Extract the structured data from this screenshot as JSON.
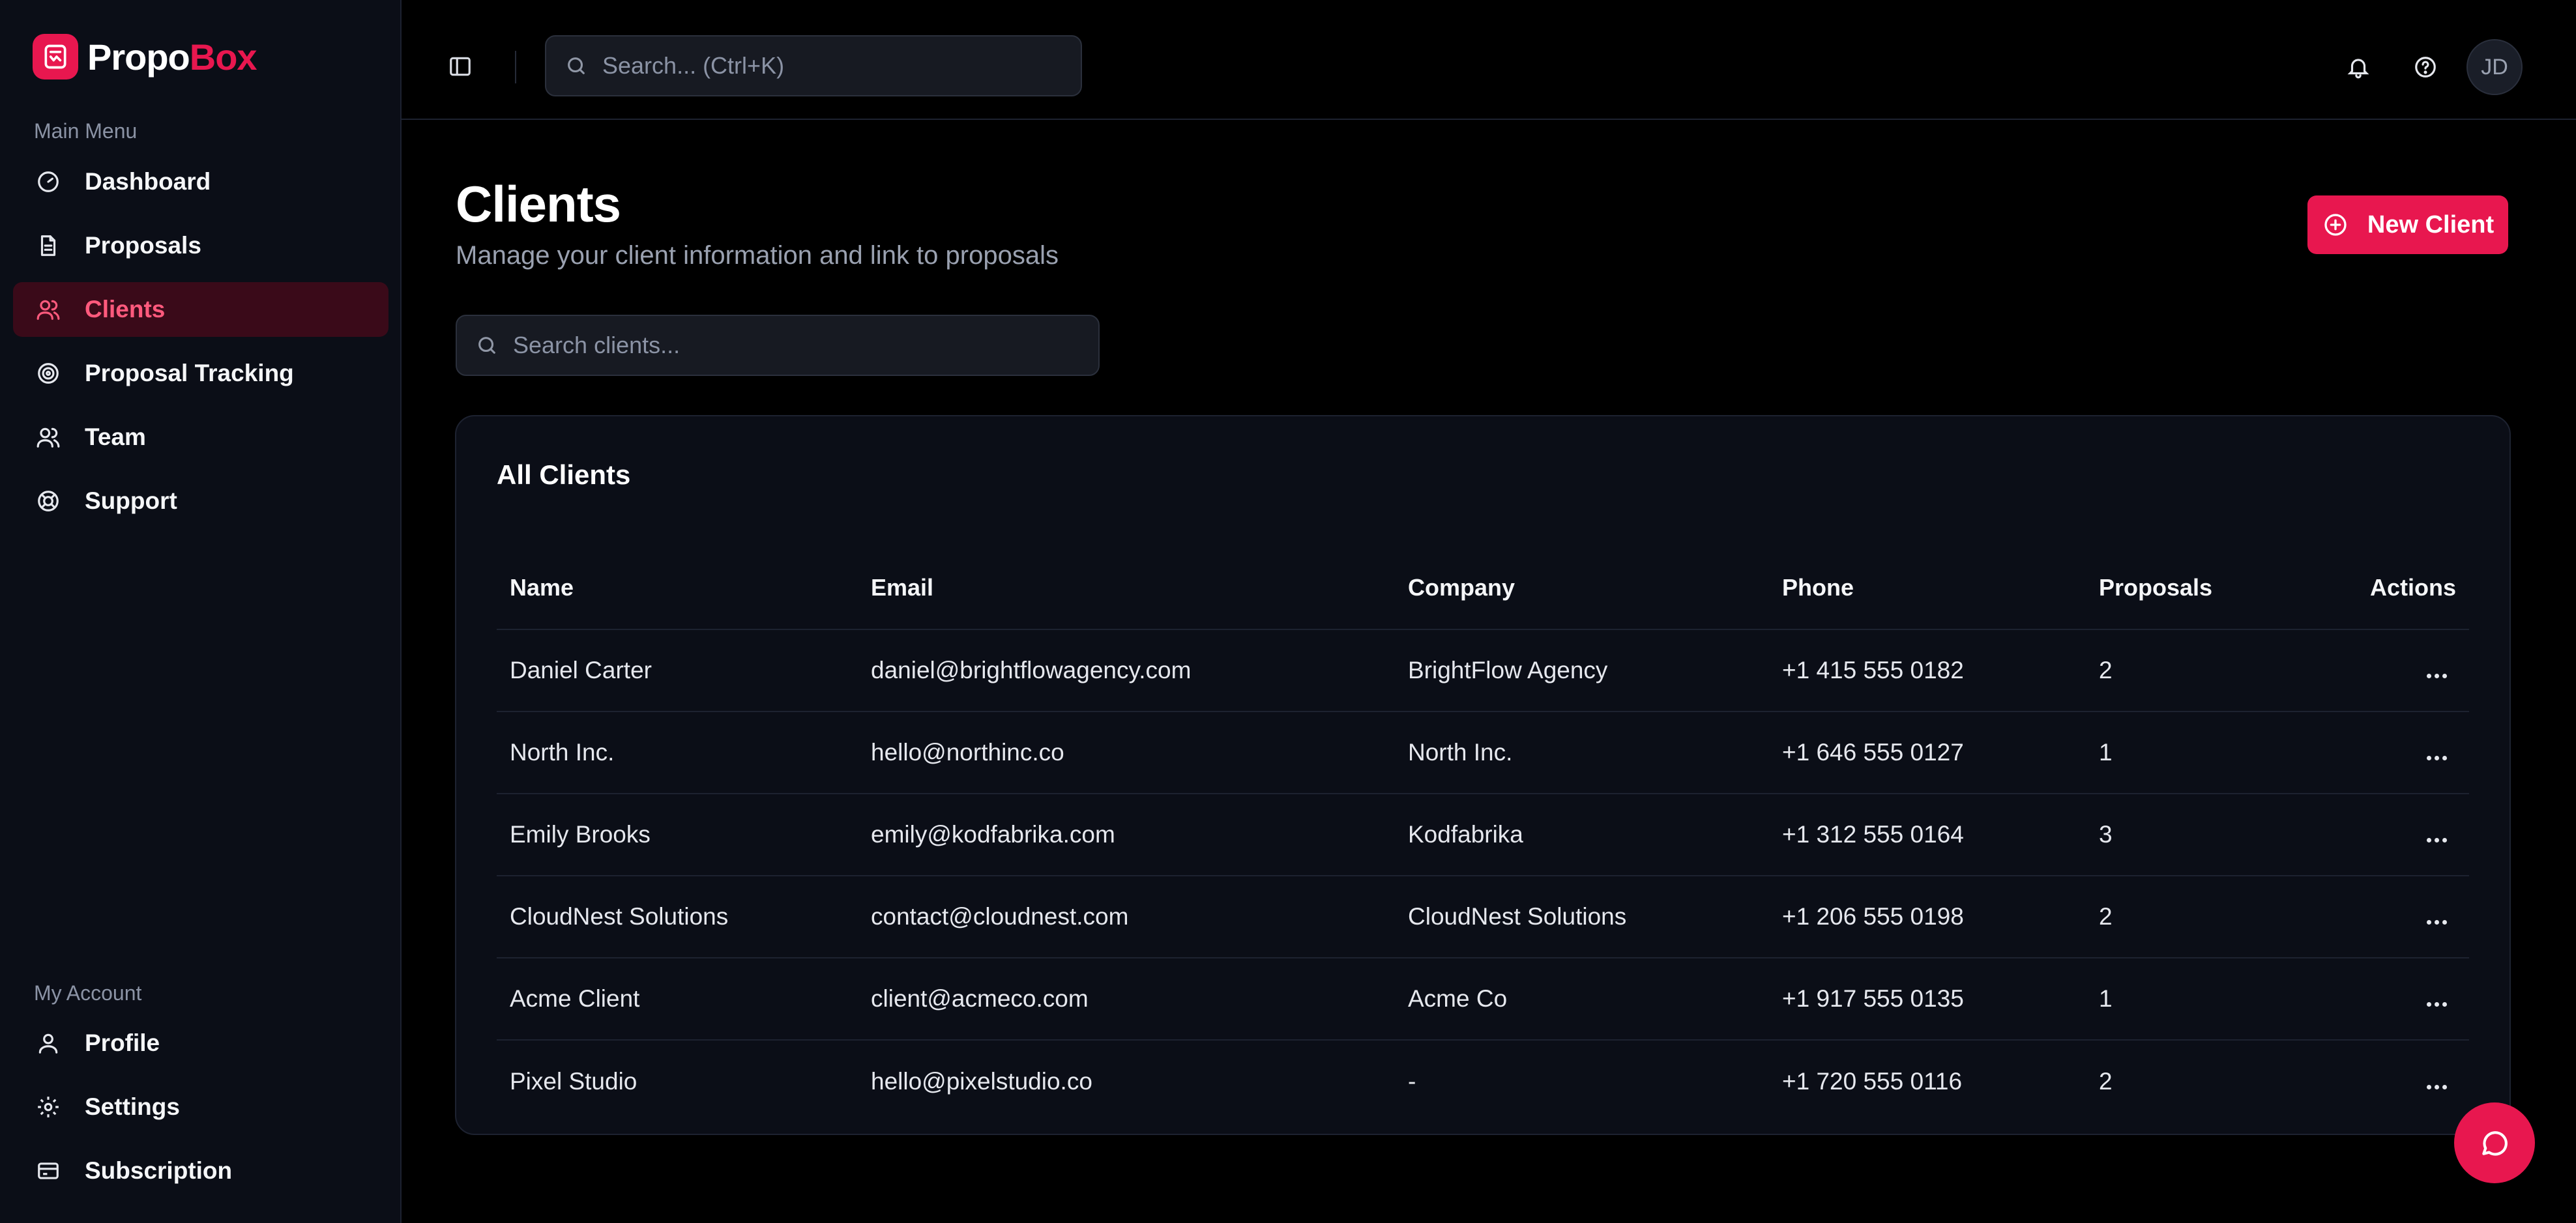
{
  "brand": {
    "name_part1": "Propo",
    "name_part2": "Box",
    "accent_color": "#e8174f"
  },
  "sidebar": {
    "main_menu_label": "Main Menu",
    "main_items": [
      {
        "label": "Dashboard",
        "icon": "gauge-icon"
      },
      {
        "label": "Proposals",
        "icon": "document-icon"
      },
      {
        "label": "Clients",
        "icon": "users-icon",
        "active": true
      },
      {
        "label": "Proposal Tracking",
        "icon": "target-icon"
      },
      {
        "label": "Team",
        "icon": "team-icon"
      },
      {
        "label": "Support",
        "icon": "lifebuoy-icon"
      }
    ],
    "account_label": "My Account",
    "account_items": [
      {
        "label": "Profile",
        "icon": "user-icon"
      },
      {
        "label": "Settings",
        "icon": "gear-icon"
      },
      {
        "label": "Subscription",
        "icon": "credit-card-icon"
      }
    ]
  },
  "topbar": {
    "search_placeholder": "Search... (Ctrl+K)",
    "avatar_initials": "JD"
  },
  "page": {
    "title": "Clients",
    "subtitle": "Manage your client information and link to proposals",
    "new_button_label": "New Client",
    "search_placeholder": "Search clients..."
  },
  "table": {
    "card_title": "All Clients",
    "columns": [
      "Name",
      "Email",
      "Company",
      "Phone",
      "Proposals",
      "Actions"
    ],
    "rows": [
      {
        "name": "Daniel Carter",
        "email": "daniel@brightflowagency.com",
        "company": "BrightFlow Agency",
        "phone": "+1 415 555 0182",
        "proposals": "2"
      },
      {
        "name": "North Inc.",
        "email": "hello@northinc.co",
        "company": "North Inc.",
        "phone": "+1 646 555 0127",
        "proposals": "1"
      },
      {
        "name": "Emily Brooks",
        "email": "emily@kodfabrika.com",
        "company": "Kodfabrika",
        "phone": "+1 312 555 0164",
        "proposals": "3"
      },
      {
        "name": "CloudNest Solutions",
        "email": "contact@cloudnest.com",
        "company": "CloudNest Solutions",
        "phone": "+1 206 555 0198",
        "proposals": "2"
      },
      {
        "name": "Acme Client",
        "email": "client@acmeco.com",
        "company": "Acme Co",
        "phone": "+1 917 555 0135",
        "proposals": "1"
      },
      {
        "name": "Pixel Studio",
        "email": "hello@pixelstudio.co",
        "company": "-",
        "phone": "+1 720 555 0116",
        "proposals": "2"
      }
    ]
  }
}
